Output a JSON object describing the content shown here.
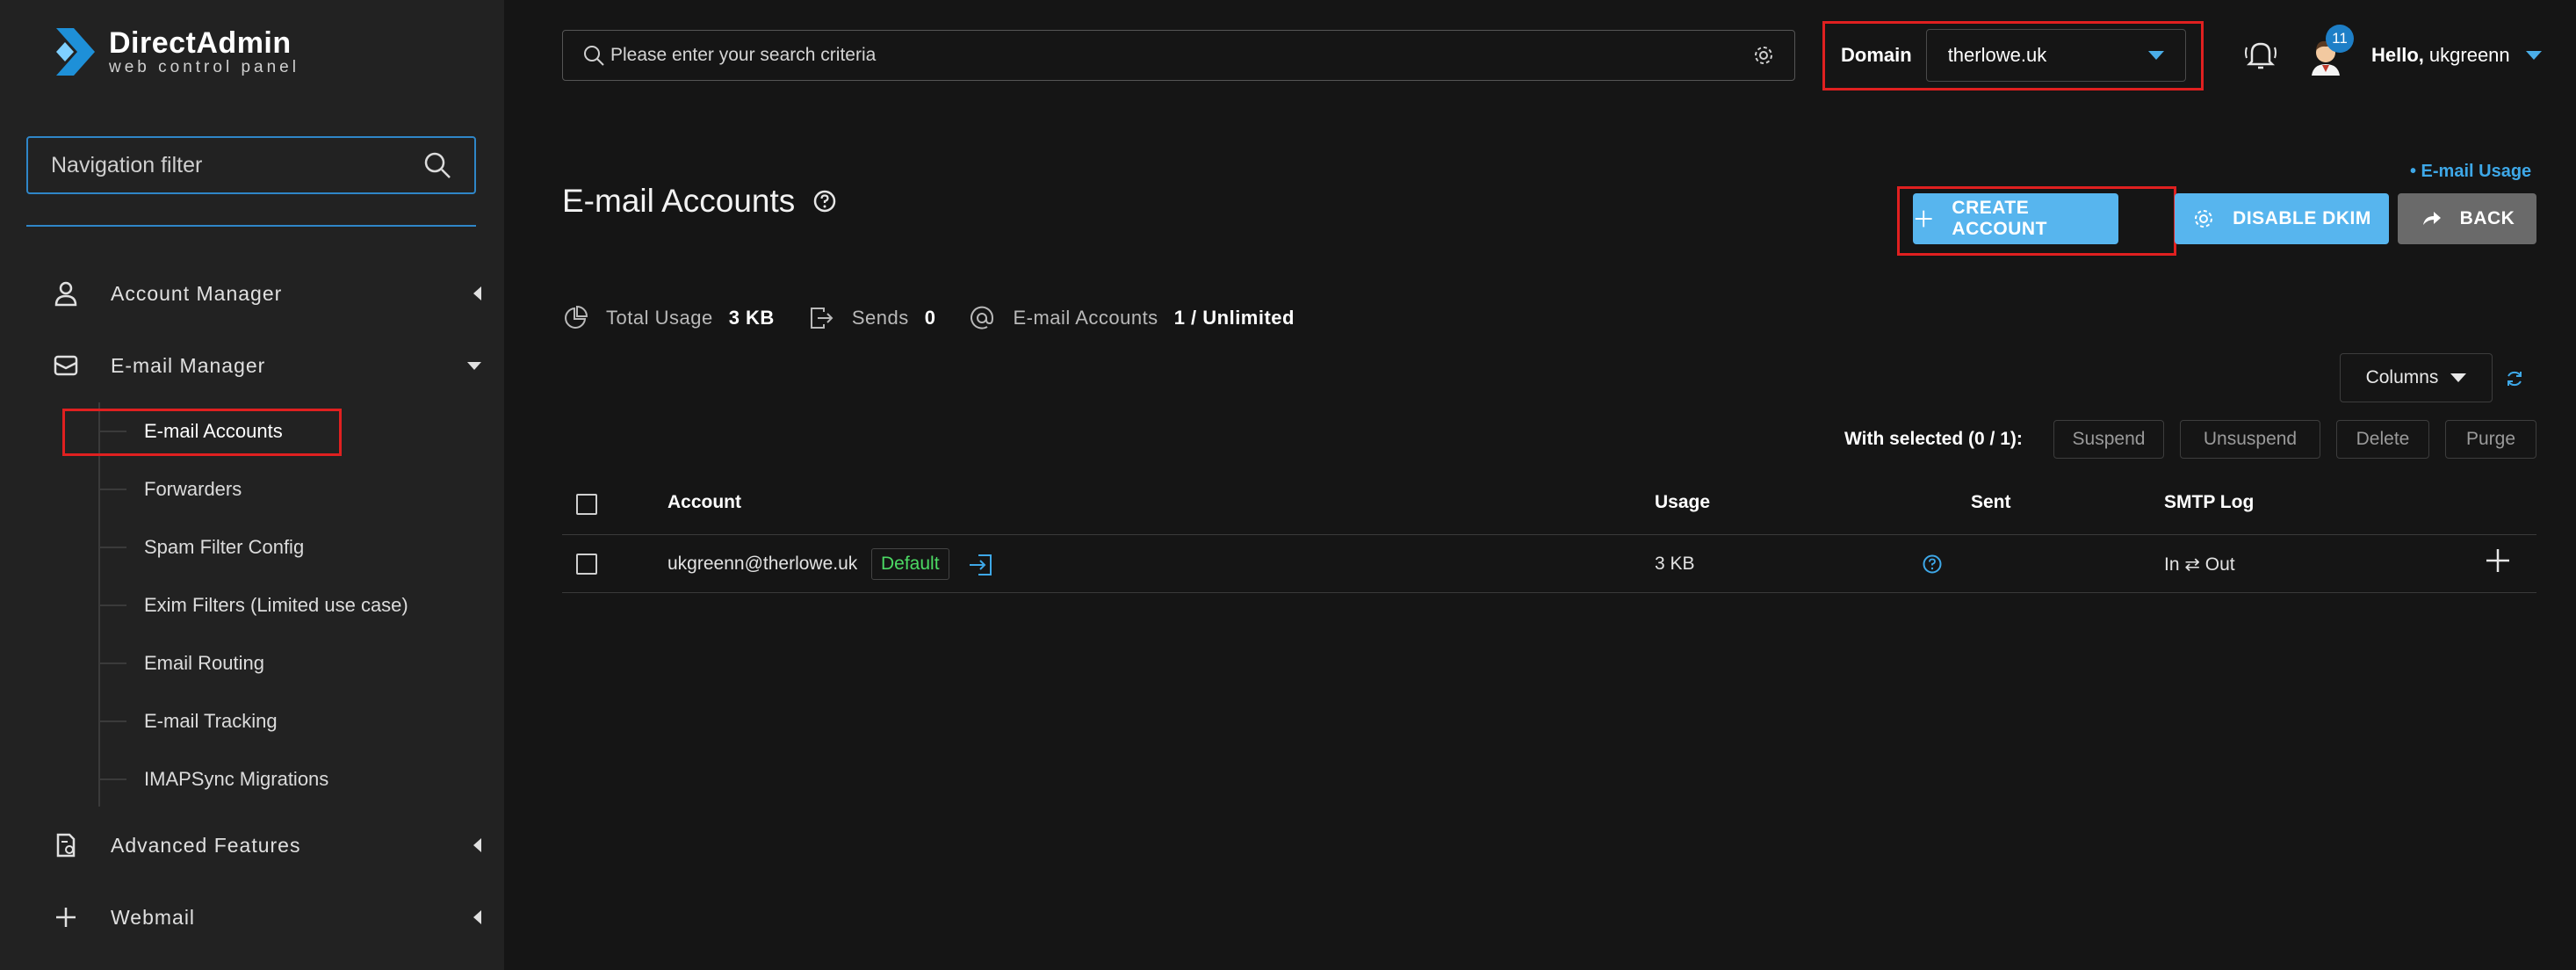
{
  "app": {
    "logo_title": "DirectAdmin",
    "logo_subtitle": "web control panel"
  },
  "sidebar": {
    "filter_placeholder": "Navigation filter",
    "items": [
      {
        "label": "Account Manager",
        "icon": "user-icon",
        "state": "collapsed"
      },
      {
        "label": "E-mail Manager",
        "icon": "envelope-icon",
        "state": "expanded"
      },
      {
        "label": "Advanced Features",
        "icon": "document-gear-icon",
        "state": "collapsed"
      },
      {
        "label": "Webmail",
        "icon": "plus-icon",
        "state": "collapsed"
      }
    ],
    "email_subitems": [
      {
        "label": "E-mail Accounts",
        "active": true
      },
      {
        "label": "Forwarders"
      },
      {
        "label": "Spam Filter Config"
      },
      {
        "label": "Exim Filters (Limited use case)"
      },
      {
        "label": "Email Routing"
      },
      {
        "label": "E-mail Tracking"
      },
      {
        "label": "IMAPSync Migrations"
      }
    ]
  },
  "topbar": {
    "search_placeholder": "Please enter your search criteria",
    "domain_label": "Domain",
    "domain_value": "therlowe.uk",
    "notification_count": "11",
    "hello_prefix": "Hello,",
    "username": "ukgreenn"
  },
  "page": {
    "title": "E-mail Accounts",
    "email_usage_link": "• E-mail Usage",
    "buttons": {
      "create": "CREATE ACCOUNT",
      "dkim": "DISABLE DKIM",
      "back": "BACK"
    },
    "stats": {
      "total_usage_label": "Total Usage",
      "total_usage_value": "3 KB",
      "sends_label": "Sends",
      "sends_value": "0",
      "accounts_label": "E-mail Accounts",
      "accounts_value": "1 / Unlimited"
    },
    "columns_label": "Columns",
    "with_selected": "With selected (0 / 1):",
    "bulk_actions": [
      "Suspend",
      "Unsuspend",
      "Delete",
      "Purge"
    ]
  },
  "table": {
    "headers": [
      "Account",
      "Usage",
      "Sent",
      "SMTP Log"
    ],
    "rows": [
      {
        "account": "ukgreenn@therlowe.uk",
        "tag": "Default",
        "usage": "3 KB",
        "smtp_log": "In ⇄ Out"
      }
    ]
  },
  "colors": {
    "accent": "#57b5ee",
    "highlight": "#e02020",
    "default_tag": "#4cd964",
    "link": "#3ea8e8"
  }
}
